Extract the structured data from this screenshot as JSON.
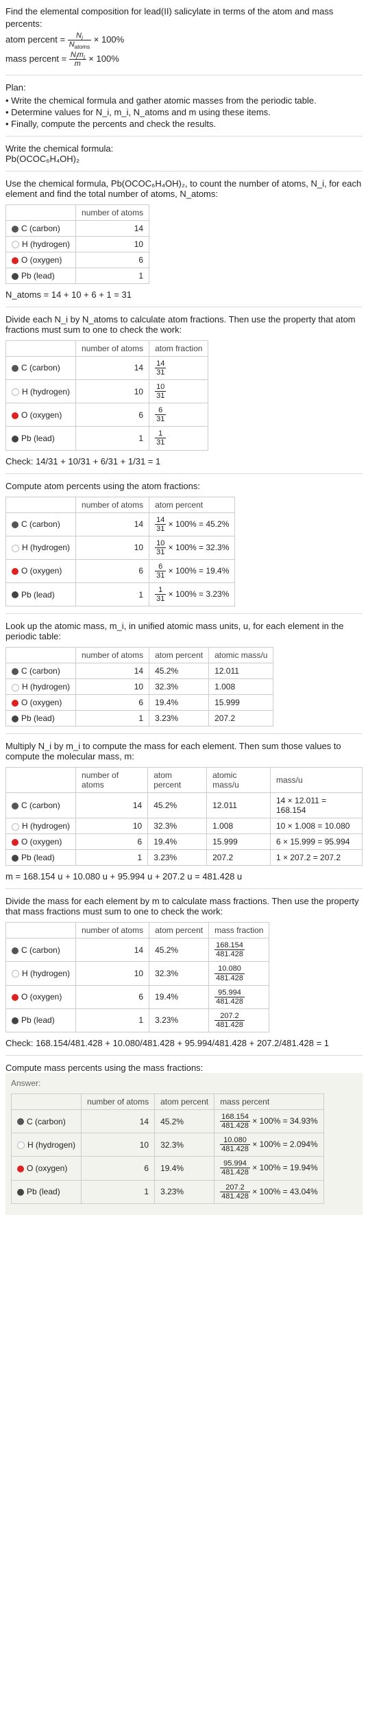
{
  "intro": {
    "title": "Find the elemental composition for lead(II) salicylate in terms of the atom and mass percents:",
    "atom_percent_label": "atom percent = ",
    "atom_percent_num": "N",
    "atom_percent_num_sub": "i",
    "atom_percent_den": "N",
    "atom_percent_den_sub": "atoms",
    "times_100": " × 100%",
    "mass_percent_label": "mass percent = ",
    "mass_percent_num1": "N",
    "mass_percent_num1_sub": "i",
    "mass_percent_num2": "m",
    "mass_percent_num2_sub": "i",
    "mass_percent_den": "m"
  },
  "plan": {
    "label": "Plan:",
    "items": [
      "Write the chemical formula and gather atomic masses from the periodic table.",
      "Determine values for N_i, m_i, N_atoms and m using these items.",
      "Finally, compute the percents and check the results."
    ]
  },
  "step_formula": {
    "label": "Write the chemical formula:",
    "formula": "Pb(OCOC₆H₄OH)₂"
  },
  "step_count": {
    "text": "Use the chemical formula, Pb(OCOC₆H₄OH)₂, to count the number of atoms, N_i, for each element and find the total number of atoms, N_atoms:",
    "headers": [
      "",
      "number of atoms"
    ],
    "rows": [
      {
        "dot": "c",
        "elem": "C (carbon)",
        "n": "14"
      },
      {
        "dot": "h",
        "elem": "H (hydrogen)",
        "n": "10"
      },
      {
        "dot": "o",
        "elem": "O (oxygen)",
        "n": "6"
      },
      {
        "dot": "pb",
        "elem": "Pb (lead)",
        "n": "1"
      }
    ],
    "total": "N_atoms = 14 + 10 + 6 + 1 = 31"
  },
  "step_fraction": {
    "text": "Divide each N_i by N_atoms to calculate atom fractions. Then use the property that atom fractions must sum to one to check the work:",
    "headers": [
      "",
      "number of atoms",
      "atom fraction"
    ],
    "rows": [
      {
        "dot": "c",
        "elem": "C (carbon)",
        "n": "14",
        "frac_num": "14",
        "frac_den": "31"
      },
      {
        "dot": "h",
        "elem": "H (hydrogen)",
        "n": "10",
        "frac_num": "10",
        "frac_den": "31"
      },
      {
        "dot": "o",
        "elem": "O (oxygen)",
        "n": "6",
        "frac_num": "6",
        "frac_den": "31"
      },
      {
        "dot": "pb",
        "elem": "Pb (lead)",
        "n": "1",
        "frac_num": "1",
        "frac_den": "31"
      }
    ],
    "check": "Check: 14/31 + 10/31 + 6/31 + 1/31 = 1"
  },
  "step_atom_percent": {
    "text": "Compute atom percents using the atom fractions:",
    "headers": [
      "",
      "number of atoms",
      "atom percent"
    ],
    "rows": [
      {
        "dot": "c",
        "elem": "C (carbon)",
        "n": "14",
        "num": "14",
        "den": "31",
        "result": " × 100% = 45.2%"
      },
      {
        "dot": "h",
        "elem": "H (hydrogen)",
        "n": "10",
        "num": "10",
        "den": "31",
        "result": " × 100% = 32.3%"
      },
      {
        "dot": "o",
        "elem": "O (oxygen)",
        "n": "6",
        "num": "6",
        "den": "31",
        "result": " × 100% = 19.4%"
      },
      {
        "dot": "pb",
        "elem": "Pb (lead)",
        "n": "1",
        "num": "1",
        "den": "31",
        "result": " × 100% = 3.23%"
      }
    ]
  },
  "step_atomic_mass": {
    "text": "Look up the atomic mass, m_i, in unified atomic mass units, u, for each element in the periodic table:",
    "headers": [
      "",
      "number of atoms",
      "atom percent",
      "atomic mass/u"
    ],
    "rows": [
      {
        "dot": "c",
        "elem": "C (carbon)",
        "n": "14",
        "p": "45.2%",
        "m": "12.011"
      },
      {
        "dot": "h",
        "elem": "H (hydrogen)",
        "n": "10",
        "p": "32.3%",
        "m": "1.008"
      },
      {
        "dot": "o",
        "elem": "O (oxygen)",
        "n": "6",
        "p": "19.4%",
        "m": "15.999"
      },
      {
        "dot": "pb",
        "elem": "Pb (lead)",
        "n": "1",
        "p": "3.23%",
        "m": "207.2"
      }
    ]
  },
  "step_mass": {
    "text": "Multiply N_i by m_i to compute the mass for each element. Then sum those values to compute the molecular mass, m:",
    "headers": [
      "",
      "number of atoms",
      "atom percent",
      "atomic mass/u",
      "mass/u"
    ],
    "rows": [
      {
        "dot": "c",
        "elem": "C (carbon)",
        "n": "14",
        "p": "45.2%",
        "m": "12.011",
        "calc": "14 × 12.011 = 168.154"
      },
      {
        "dot": "h",
        "elem": "H (hydrogen)",
        "n": "10",
        "p": "32.3%",
        "m": "1.008",
        "calc": "10 × 1.008 = 10.080"
      },
      {
        "dot": "o",
        "elem": "O (oxygen)",
        "n": "6",
        "p": "19.4%",
        "m": "15.999",
        "calc": "6 × 15.999 = 95.994"
      },
      {
        "dot": "pb",
        "elem": "Pb (lead)",
        "n": "1",
        "p": "3.23%",
        "m": "207.2",
        "calc": "1 × 207.2 = 207.2"
      }
    ],
    "total": "m = 168.154 u + 10.080 u + 95.994 u + 207.2 u = 481.428 u"
  },
  "step_mass_fraction": {
    "text": "Divide the mass for each element by m to calculate mass fractions. Then use the property that mass fractions must sum to one to check the work:",
    "headers": [
      "",
      "number of atoms",
      "atom percent",
      "mass fraction"
    ],
    "rows": [
      {
        "dot": "c",
        "elem": "C (carbon)",
        "n": "14",
        "p": "45.2%",
        "num": "168.154",
        "den": "481.428"
      },
      {
        "dot": "h",
        "elem": "H (hydrogen)",
        "n": "10",
        "p": "32.3%",
        "num": "10.080",
        "den": "481.428"
      },
      {
        "dot": "o",
        "elem": "O (oxygen)",
        "n": "6",
        "p": "19.4%",
        "num": "95.994",
        "den": "481.428"
      },
      {
        "dot": "pb",
        "elem": "Pb (lead)",
        "n": "1",
        "p": "3.23%",
        "num": "207.2",
        "den": "481.428"
      }
    ],
    "check": "Check: 168.154/481.428 + 10.080/481.428 + 95.994/481.428 + 207.2/481.428 = 1"
  },
  "answer": {
    "text": "Compute mass percents using the mass fractions:",
    "label": "Answer:",
    "headers": [
      "",
      "number of atoms",
      "atom percent",
      "mass percent"
    ],
    "rows": [
      {
        "dot": "c",
        "elem": "C (carbon)",
        "n": "14",
        "p": "45.2%",
        "num": "168.154",
        "den": "481.428",
        "result": " × 100% = 34.93%"
      },
      {
        "dot": "h",
        "elem": "H (hydrogen)",
        "n": "10",
        "p": "32.3%",
        "num": "10.080",
        "den": "481.428",
        "result": " × 100% = 2.094%"
      },
      {
        "dot": "o",
        "elem": "O (oxygen)",
        "n": "6",
        "p": "19.4%",
        "num": "95.994",
        "den": "481.428",
        "result": " × 100% = 19.94%"
      },
      {
        "dot": "pb",
        "elem": "Pb (lead)",
        "n": "1",
        "p": "3.23%",
        "num": "207.2",
        "den": "481.428",
        "result": " × 100% = 43.04%"
      }
    ]
  },
  "chart_data": {
    "type": "table",
    "title": "Elemental composition of lead(II) salicylate Pb(OCOC6H4OH)2",
    "molecular_mass_u": 481.428,
    "N_atoms": 31,
    "elements": [
      {
        "element": "C",
        "name": "carbon",
        "atoms": 14,
        "atom_fraction": "14/31",
        "atom_percent": 45.2,
        "atomic_mass_u": 12.011,
        "mass_u": 168.154,
        "mass_fraction": "168.154/481.428",
        "mass_percent": 34.93
      },
      {
        "element": "H",
        "name": "hydrogen",
        "atoms": 10,
        "atom_fraction": "10/31",
        "atom_percent": 32.3,
        "atomic_mass_u": 1.008,
        "mass_u": 10.08,
        "mass_fraction": "10.080/481.428",
        "mass_percent": 2.094
      },
      {
        "element": "O",
        "name": "oxygen",
        "atoms": 6,
        "atom_fraction": "6/31",
        "atom_percent": 19.4,
        "atomic_mass_u": 15.999,
        "mass_u": 95.994,
        "mass_fraction": "95.994/481.428",
        "mass_percent": 19.94
      },
      {
        "element": "Pb",
        "name": "lead",
        "atoms": 1,
        "atom_fraction": "1/31",
        "atom_percent": 3.23,
        "atomic_mass_u": 207.2,
        "mass_u": 207.2,
        "mass_fraction": "207.2/481.428",
        "mass_percent": 43.04
      }
    ]
  }
}
